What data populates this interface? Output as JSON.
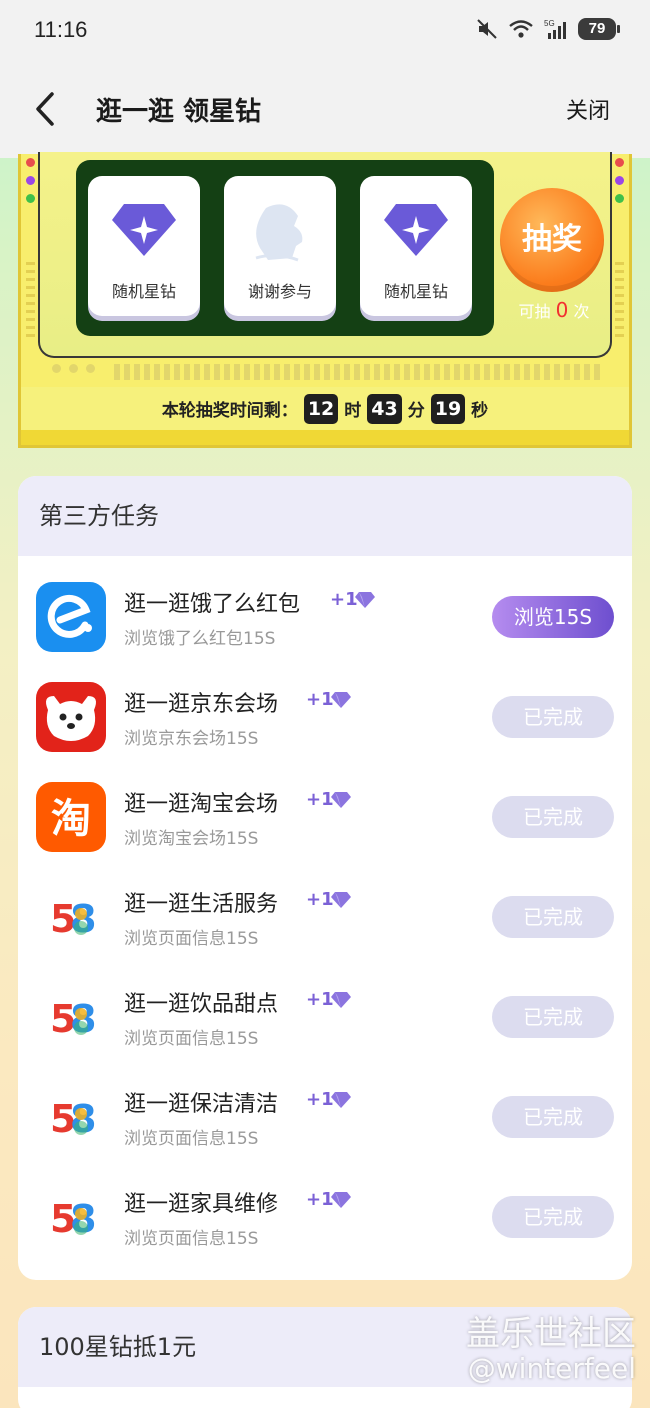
{
  "status_bar": {
    "time": "11:16",
    "battery": "79"
  },
  "nav": {
    "title": "逛一逛 领星钻",
    "close": "关闭"
  },
  "lottery": {
    "prizes": [
      "随机星钻",
      "谢谢参与",
      "随机星钻"
    ],
    "draw_button": "抽奖",
    "count_prefix": "可抽",
    "count_value": "0",
    "count_suffix": "次",
    "timer_label": "本轮抽奖时间剩：",
    "hours": "12",
    "hours_unit": "时",
    "minutes": "43",
    "minutes_unit": "分",
    "seconds": "19",
    "seconds_unit": "秒"
  },
  "tasks_card": {
    "title": "第三方任务",
    "items": [
      {
        "title": "逛一逛饿了么红包",
        "reward": "+1",
        "subtitle": "浏览饿了么红包15S",
        "button": "浏览15S",
        "state": "active",
        "icon": "eleme-icon"
      },
      {
        "title": "逛一逛京东会场",
        "reward": "+1",
        "subtitle": "浏览京东会场15S",
        "button": "已完成",
        "state": "done",
        "icon": "jd-icon"
      },
      {
        "title": "逛一逛淘宝会场",
        "reward": "+1",
        "subtitle": "浏览淘宝会场15S",
        "button": "已完成",
        "state": "done",
        "icon": "taobao-icon"
      },
      {
        "title": "逛一逛生活服务",
        "reward": "+1",
        "subtitle": "浏览页面信息15S",
        "button": "已完成",
        "state": "done",
        "icon": "58-icon"
      },
      {
        "title": "逛一逛饮品甜点",
        "reward": "+1",
        "subtitle": "浏览页面信息15S",
        "button": "已完成",
        "state": "done",
        "icon": "58-icon"
      },
      {
        "title": "逛一逛保洁清洁",
        "reward": "+1",
        "subtitle": "浏览页面信息15S",
        "button": "已完成",
        "state": "done",
        "icon": "58-icon"
      },
      {
        "title": "逛一逛家具维修",
        "reward": "+1",
        "subtitle": "浏览页面信息15S",
        "button": "已完成",
        "state": "done",
        "icon": "58-icon"
      }
    ]
  },
  "redeem_card": {
    "title": "100星钻抵1元"
  },
  "watermark": {
    "line1": "盖乐世社区",
    "line2": "@winterfeel"
  },
  "colors": {
    "accent": "#7b61d6",
    "draw": "#fb7c1c",
    "done": "#dcdcef"
  }
}
